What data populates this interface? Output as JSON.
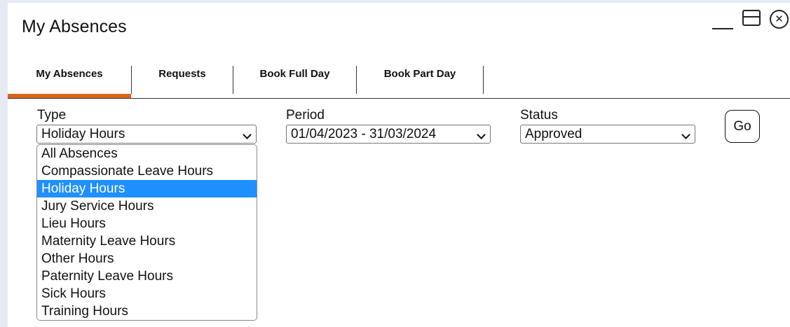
{
  "window": {
    "title": "My Absences",
    "controls": {
      "minimize_icon": "minimize-icon",
      "maximize_icon": "maximize-icon",
      "close_icon": "close-icon",
      "close_glyph": "✕"
    }
  },
  "tabs": [
    {
      "label": "My Absences",
      "active": true
    },
    {
      "label": "Requests",
      "active": false
    },
    {
      "label": "Book Full Day",
      "active": false
    },
    {
      "label": "Book Part Day",
      "active": false
    }
  ],
  "filters": {
    "type": {
      "label": "Type",
      "value": "Holiday Hours"
    },
    "period": {
      "label": "Period",
      "value": "01/04/2023 - 31/03/2024"
    },
    "status": {
      "label": "Status",
      "value": "Approved"
    },
    "go_label": "Go"
  },
  "type_dropdown": {
    "options": [
      "All Absences",
      "Compassionate Leave Hours",
      "Holiday Hours",
      "Jury Service Hours",
      "Lieu Hours",
      "Maternity Leave Hours",
      "Other Hours",
      "Paternity Leave Hours",
      "Sick Hours",
      "Training Hours"
    ],
    "selected_index": 2
  },
  "colors": {
    "accent": "#d9641c",
    "selection": "#1e90ff",
    "background": "#e8eaf3"
  }
}
